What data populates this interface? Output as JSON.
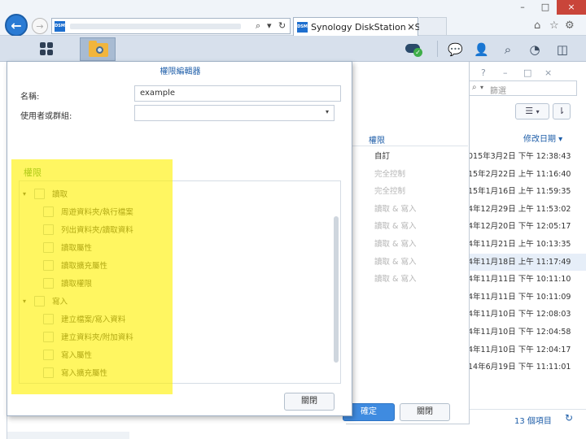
{
  "browser": {
    "tab_title": "Synology DiskStation - Sy...",
    "favicon_text": "DSM",
    "tab_close": "×",
    "back_glyph": "←",
    "forward_glyph": "→",
    "address_search_glyph": "⌕",
    "address_dropdown_glyph": "▾",
    "address_refresh_glyph": "↻",
    "window_minimize": "–",
    "window_maximize": "□",
    "window_close": "×",
    "home_glyph": "⌂",
    "favorites_glyph": "☆",
    "settings_glyph": "⚙",
    "icons": [
      "back-arrow-icon",
      "forward-arrow-icon",
      "home-icon",
      "star-icon",
      "gear-icon"
    ]
  },
  "dsm_taskbar": {
    "icons": [
      "main-menu-icon",
      "file-station-icon",
      "cloud-sync-icon",
      "chat-icon",
      "user-icon",
      "search-icon",
      "dashboard-icon",
      "widgets-icon"
    ],
    "chat_glyph": "💬",
    "user_glyph": "👤",
    "search_glyph": "⌕",
    "dashboard_glyph": "◔",
    "widgets_glyph": "◫",
    "sync_check": "✓"
  },
  "file_station": {
    "window_controls": [
      "?",
      "–",
      "□",
      "×"
    ],
    "filter_placeholder": "篩選",
    "search_glyph": "⌕",
    "filter_caret": "▾",
    "view_list_glyph": "☰",
    "view_caret": "▾",
    "sort_glyph": "⇂",
    "date_column_header": "修改日期 ▾",
    "dates": [
      "015年3月2日 下午 12:38:43",
      "15年2月22日 上午 11:16:40",
      "15年1月16日 上午 11:59:35",
      "4年12月29日 上午 11:53:02",
      "4年12月20日 下午 12:05:17",
      "4年11月21日 上午 10:13:35",
      "4年11月18日 上午 11:17:49",
      "4年11月11日 下午 10:11:10",
      "4年11月11日 下午 10:11:09",
      "4年11月10日 下午 12:08:03",
      "4年11月10日 下午 12:04:58",
      "4年11月10日 下午 12:04:17",
      "14年6月19日 下午 11:11:01"
    ],
    "item_count": "13 個項目",
    "refresh_glyph": "↻"
  },
  "acl_dialog": {
    "column_header": "權限",
    "permissions": [
      "自訂",
      "完全控制",
      "完全控制",
      "讀取 & 寫入",
      "讀取 & 寫入",
      "讀取 & 寫入",
      "讀取 & 寫入",
      "讀取 & 寫入"
    ],
    "confirm_label": "確定",
    "close_label": "關閉"
  },
  "perm_editor": {
    "title": "權限編輯器",
    "name_label": "名稱:",
    "name_value": "example",
    "user_group_label": "使用者或群組:",
    "user_group_value": "",
    "select_caret": "▾",
    "section_title": "權限",
    "groups": [
      {
        "label": "讀取",
        "arrow": "▾",
        "items": [
          "周遊資料夾/執行檔案",
          "列出資料夾/讀取資料",
          "讀取屬性",
          "讀取擴充屬性",
          "讀取權限"
        ]
      },
      {
        "label": "寫入",
        "arrow": "▾",
        "items": [
          "建立檔案/寫入資料",
          "建立資料夾/附加資料",
          "寫入屬性",
          "寫入擴充屬性"
        ]
      }
    ],
    "close_label": "關閉"
  },
  "colors": {
    "accent_blue": "#1d5da8",
    "primary_button": "#3f8be0",
    "section_green": "#2e8b3a",
    "highlight_yellow": "#fff000"
  }
}
